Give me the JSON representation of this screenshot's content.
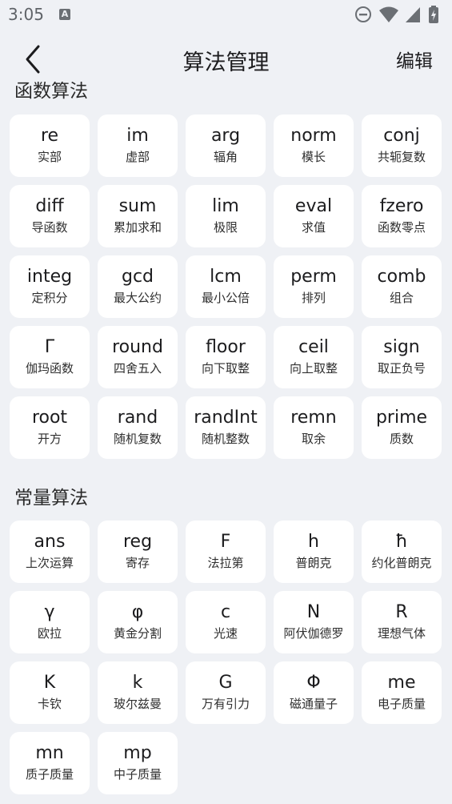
{
  "status_bar": {
    "time": "3:05",
    "a_icon": "A"
  },
  "header": {
    "title": "算法管理",
    "edit_label": "编辑"
  },
  "sections": [
    {
      "title": "函数算法",
      "items": [
        {
          "symbol": "re",
          "label": "实部"
        },
        {
          "symbol": "im",
          "label": "虚部"
        },
        {
          "symbol": "arg",
          "label": "辐角"
        },
        {
          "symbol": "norm",
          "label": "模长"
        },
        {
          "symbol": "conj",
          "label": "共轭复数"
        },
        {
          "symbol": "diff",
          "label": "导函数"
        },
        {
          "symbol": "sum",
          "label": "累加求和"
        },
        {
          "symbol": "lim",
          "label": "极限"
        },
        {
          "symbol": "eval",
          "label": "求值"
        },
        {
          "symbol": "fzero",
          "label": "函数零点"
        },
        {
          "symbol": "integ",
          "label": "定积分"
        },
        {
          "symbol": "gcd",
          "label": "最大公约"
        },
        {
          "symbol": "lcm",
          "label": "最小公倍"
        },
        {
          "symbol": "perm",
          "label": "排列"
        },
        {
          "symbol": "comb",
          "label": "组合"
        },
        {
          "symbol": "Γ",
          "label": "伽玛函数"
        },
        {
          "symbol": "round",
          "label": "四舍五入"
        },
        {
          "symbol": "floor",
          "label": "向下取整"
        },
        {
          "symbol": "ceil",
          "label": "向上取整"
        },
        {
          "symbol": "sign",
          "label": "取正负号"
        },
        {
          "symbol": "root",
          "label": "开方"
        },
        {
          "symbol": "rand",
          "label": "随机复数"
        },
        {
          "symbol": "randInt",
          "label": "随机整数"
        },
        {
          "symbol": "remn",
          "label": "取余"
        },
        {
          "symbol": "prime",
          "label": "质数"
        }
      ]
    },
    {
      "title": "常量算法",
      "items": [
        {
          "symbol": "ans",
          "label": "上次运算"
        },
        {
          "symbol": "reg",
          "label": "寄存"
        },
        {
          "symbol": "F",
          "label": "法拉第"
        },
        {
          "symbol": "h",
          "label": "普朗克"
        },
        {
          "symbol": "ħ",
          "label": "约化普朗克"
        },
        {
          "symbol": "γ",
          "label": "欧拉"
        },
        {
          "symbol": "φ",
          "label": "黄金分割"
        },
        {
          "symbol": "c",
          "label": "光速"
        },
        {
          "symbol": "N",
          "label": "阿伏伽德罗"
        },
        {
          "symbol": "R",
          "label": "理想气体"
        },
        {
          "symbol": "K",
          "label": "卡钦"
        },
        {
          "symbol": "k",
          "label": "玻尔兹曼"
        },
        {
          "symbol": "G",
          "label": "万有引力"
        },
        {
          "symbol": "Φ",
          "label": "磁通量子"
        },
        {
          "symbol": "me",
          "label": "电子质量"
        },
        {
          "symbol": "mn",
          "label": "质子质量"
        },
        {
          "symbol": "mp",
          "label": "中子质量"
        }
      ]
    }
  ]
}
